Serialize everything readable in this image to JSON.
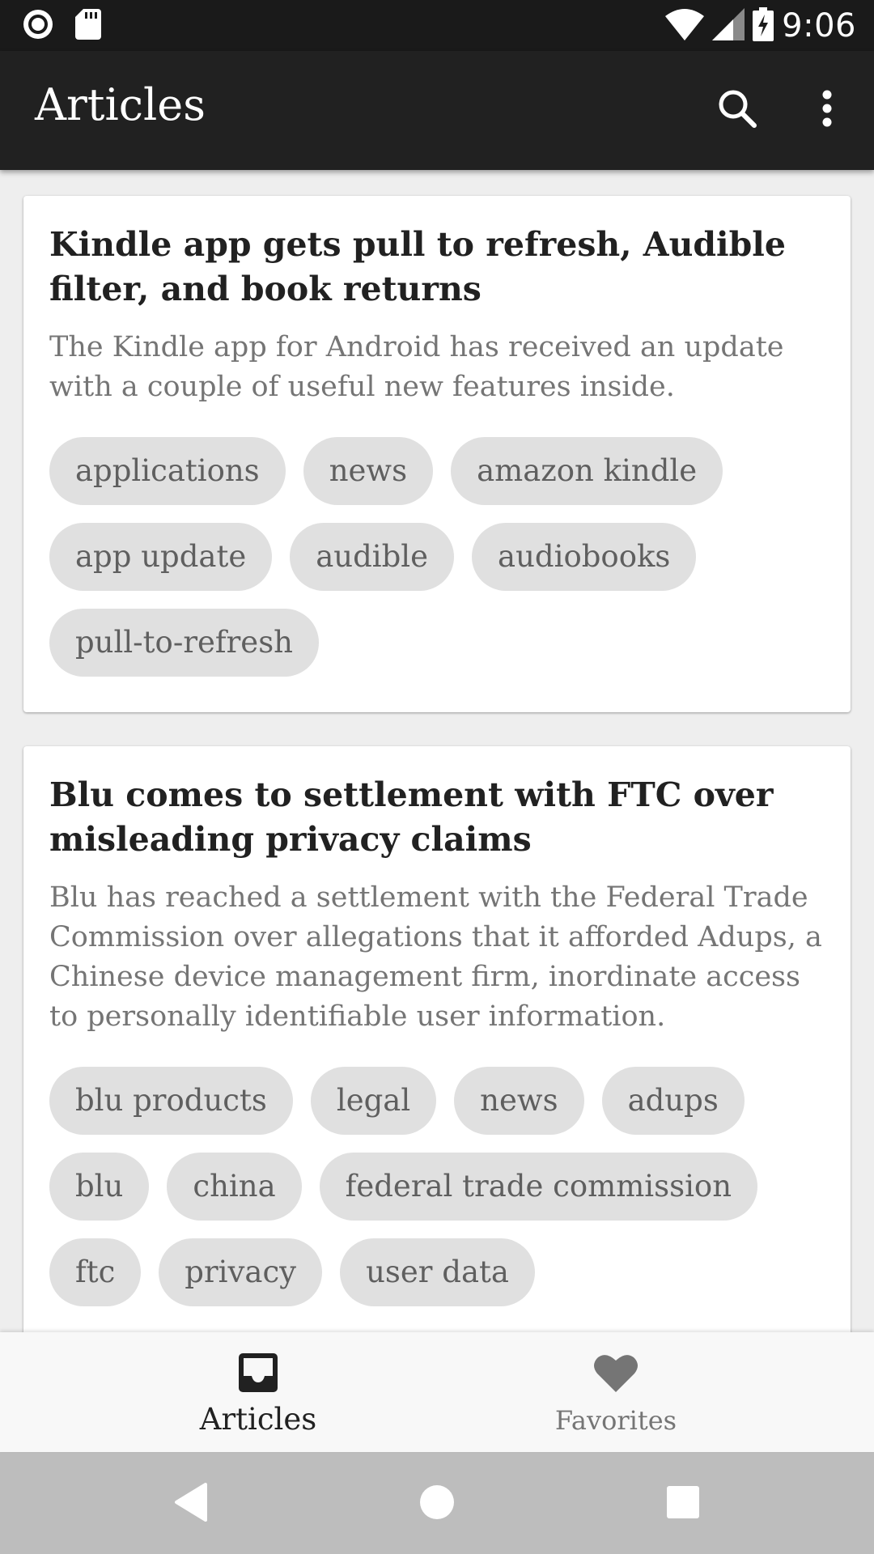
{
  "status_bar": {
    "time": "9:06",
    "icons": [
      "record-icon",
      "sd-card-icon",
      "wifi-icon",
      "cell-signal-icon",
      "battery-charging-icon"
    ]
  },
  "app_bar": {
    "title": "Articles",
    "actions": [
      "search-icon",
      "more-vert-icon"
    ]
  },
  "articles": [
    {
      "title": "Kindle app gets pull to refresh, Audible filter, and book returns",
      "summary": "The Kindle app for Android has received an update with a couple of useful new features inside.",
      "tags": [
        "applications",
        "news",
        "amazon kindle",
        "app update",
        "audible",
        "audiobooks",
        "pull-to-refresh"
      ]
    },
    {
      "title": "Blu comes to settlement with FTC over misleading privacy claims",
      "summary": "Blu has reached a settlement with the Federal Trade Commission over allegations that it afforded Adups, a Chinese device management firm, inordinate access to personally identifiable user information.",
      "tags": [
        "blu products",
        "legal",
        "news",
        "adups",
        "blu",
        "china",
        "federal trade commission",
        "ftc",
        "privacy",
        "user data"
      ]
    }
  ],
  "bottom_nav": {
    "tabs": [
      {
        "label": "Articles",
        "icon": "inbox-icon",
        "active": true
      },
      {
        "label": "Favorites",
        "icon": "heart-icon",
        "active": false
      }
    ]
  },
  "system_nav": {
    "buttons": [
      "back-icon",
      "home-icon",
      "recents-icon"
    ]
  },
  "colors": {
    "status_bar": "#1a1a1a",
    "app_bar": "#212121",
    "background": "#eeeeee",
    "card": "#ffffff",
    "chip": "#e0e0e0",
    "system_nav": "#bdbdbd"
  }
}
